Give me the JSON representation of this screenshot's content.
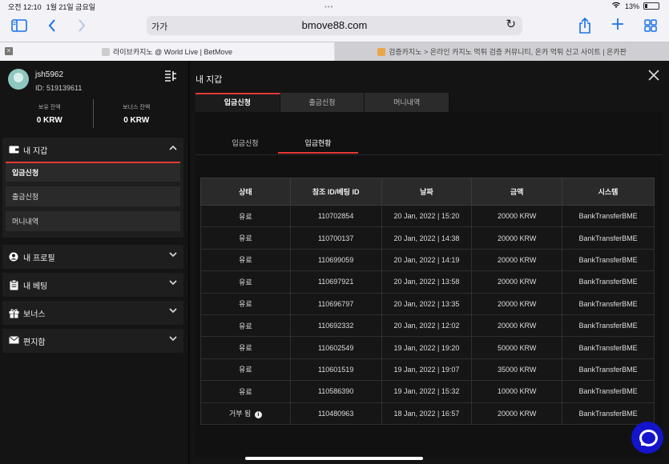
{
  "status": {
    "time": "오전 12:10",
    "date": "1월 21일 금요일",
    "battery": "13%"
  },
  "browser": {
    "reader_label": "가가",
    "domain": "bmove88.com",
    "tabs": [
      {
        "title": "라이브카지노 @ World Live | BetMove"
      },
      {
        "title": "검증카지노 > 온라인 카지노 먹튀 검증 커뮤니티, 온카 먹튀 신고 사이트 | 온카판"
      }
    ]
  },
  "profile": {
    "username": "jsh5962",
    "id_text": "ID: 519139611",
    "balance_label": "보유 잔액",
    "balance_value": "0 KRW",
    "bonus_label": "보너스 잔액",
    "bonus_value": "0 KRW"
  },
  "sidebar": {
    "wallet": "내 지갑",
    "wallet_items": [
      "입금신청",
      "출금신청",
      "머니내역"
    ],
    "profile": "내 프로필",
    "betting": "내 베팅",
    "bonus": "보너스",
    "mailbox": "편지함"
  },
  "modal": {
    "title": "내 지갑",
    "main_tabs": [
      "입금신청",
      "출금신청",
      "머니내역"
    ],
    "sub_tabs": [
      "입금신청",
      "입금현황"
    ]
  },
  "table": {
    "headers": [
      "상태",
      "참조 ID/베팅 ID",
      "날짜",
      "금액",
      "시스템"
    ],
    "rows": [
      [
        "유료",
        "110702854",
        "20 Jan, 2022 | 15:20",
        "20000 KRW",
        "BankTransferBME"
      ],
      [
        "유료",
        "110700137",
        "20 Jan, 2022 | 14:38",
        "20000 KRW",
        "BankTransferBME"
      ],
      [
        "유료",
        "110699059",
        "20 Jan, 2022 | 14:19",
        "20000 KRW",
        "BankTransferBME"
      ],
      [
        "유료",
        "110697921",
        "20 Jan, 2022 | 13:58",
        "20000 KRW",
        "BankTransferBME"
      ],
      [
        "유료",
        "110696797",
        "20 Jan, 2022 | 13:35",
        "20000 KRW",
        "BankTransferBME"
      ],
      [
        "유료",
        "110692332",
        "20 Jan, 2022 | 12:02",
        "20000 KRW",
        "BankTransferBME"
      ],
      [
        "유료",
        "110602549",
        "19 Jan, 2022 | 19:20",
        "50000 KRW",
        "BankTransferBME"
      ],
      [
        "유료",
        "110601519",
        "19 Jan, 2022 | 19:07",
        "35000 KRW",
        "BankTransferBME"
      ],
      [
        "유료",
        "110586390",
        "19 Jan, 2022 | 15:32",
        "10000 KRW",
        "BankTransferBME"
      ],
      [
        "거부 됨",
        "110480963",
        "18 Jan, 2022 | 16:57",
        "20000 KRW",
        "BankTransferBME"
      ]
    ]
  },
  "colors": {
    "accent": "#e53935",
    "chat": "#1414cc"
  }
}
